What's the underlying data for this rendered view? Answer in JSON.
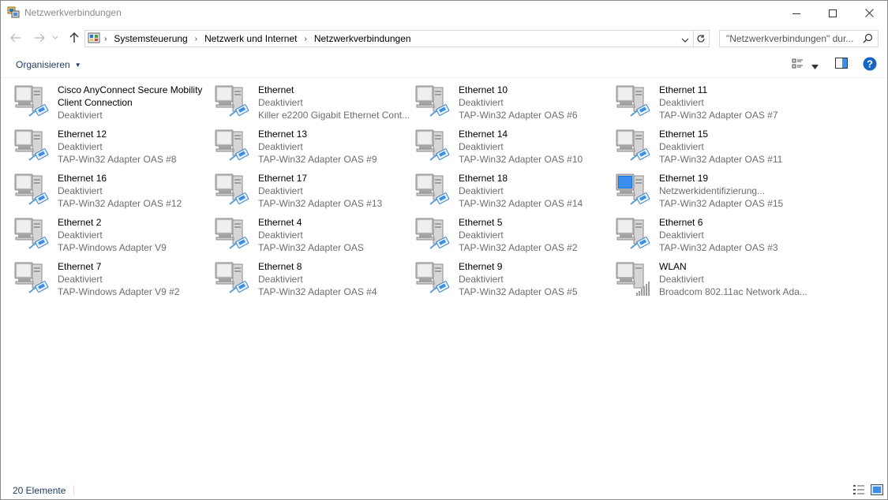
{
  "window": {
    "title": "Netzwerkverbindungen"
  },
  "address": {
    "crumbs": [
      "Systemsteuerung",
      "Netzwerk und Internet",
      "Netzwerkverbindungen"
    ],
    "search_placeholder": "\"Netzwerkverbindungen\" dur..."
  },
  "toolbar": {
    "organize_label": "Organisieren"
  },
  "items": [
    {
      "name": "Cisco AnyConnect Secure Mobility Client Connection",
      "status": "Deaktiviert",
      "device": "",
      "icon": "disabled-ethernet"
    },
    {
      "name": "Ethernet",
      "status": "Deaktiviert",
      "device": "Killer e2200 Gigabit Ethernet Cont...",
      "icon": "disabled-ethernet"
    },
    {
      "name": "Ethernet 10",
      "status": "Deaktiviert",
      "device": "TAP-Win32 Adapter OAS #6",
      "icon": "disabled-ethernet"
    },
    {
      "name": "Ethernet 11",
      "status": "Deaktiviert",
      "device": "TAP-Win32 Adapter OAS #7",
      "icon": "disabled-ethernet"
    },
    {
      "name": "Ethernet 12",
      "status": "Deaktiviert",
      "device": "TAP-Win32 Adapter OAS #8",
      "icon": "disabled-ethernet"
    },
    {
      "name": "Ethernet 13",
      "status": "Deaktiviert",
      "device": "TAP-Win32 Adapter OAS #9",
      "icon": "disabled-ethernet"
    },
    {
      "name": "Ethernet 14",
      "status": "Deaktiviert",
      "device": "TAP-Win32 Adapter OAS #10",
      "icon": "disabled-ethernet"
    },
    {
      "name": "Ethernet 15",
      "status": "Deaktiviert",
      "device": "TAP-Win32 Adapter OAS #11",
      "icon": "disabled-ethernet"
    },
    {
      "name": "Ethernet 16",
      "status": "Deaktiviert",
      "device": "TAP-Win32 Adapter OAS #12",
      "icon": "disabled-ethernet"
    },
    {
      "name": "Ethernet 17",
      "status": "Deaktiviert",
      "device": "TAP-Win32 Adapter OAS #13",
      "icon": "disabled-ethernet"
    },
    {
      "name": "Ethernet 18",
      "status": "Deaktiviert",
      "device": "TAP-Win32 Adapter OAS #14",
      "icon": "disabled-ethernet"
    },
    {
      "name": "Ethernet 19",
      "status": "Netzwerkidentifizierung...",
      "device": "TAP-Win32 Adapter OAS #15",
      "icon": "active-ethernet"
    },
    {
      "name": "Ethernet 2",
      "status": "Deaktiviert",
      "device": "TAP-Windows Adapter V9",
      "icon": "disabled-ethernet"
    },
    {
      "name": "Ethernet 4",
      "status": "Deaktiviert",
      "device": "TAP-Win32 Adapter OAS",
      "icon": "disabled-ethernet"
    },
    {
      "name": "Ethernet 5",
      "status": "Deaktiviert",
      "device": "TAP-Win32 Adapter OAS #2",
      "icon": "disabled-ethernet"
    },
    {
      "name": "Ethernet 6",
      "status": "Deaktiviert",
      "device": "TAP-Win32 Adapter OAS #3",
      "icon": "disabled-ethernet"
    },
    {
      "name": "Ethernet 7",
      "status": "Deaktiviert",
      "device": "TAP-Windows Adapter V9 #2",
      "icon": "disabled-ethernet"
    },
    {
      "name": "Ethernet 8",
      "status": "Deaktiviert",
      "device": "TAP-Win32 Adapter OAS #4",
      "icon": "disabled-ethernet"
    },
    {
      "name": "Ethernet 9",
      "status": "Deaktiviert",
      "device": "TAP-Win32 Adapter OAS #5",
      "icon": "disabled-ethernet"
    },
    {
      "name": "WLAN",
      "status": "Deaktiviert",
      "device": "Broadcom 802.11ac Network Ada...",
      "icon": "wifi-signal"
    }
  ],
  "statusbar": {
    "count_label": "20 Elemente"
  },
  "colors": {
    "accent": "#0063b1",
    "text_link": "#1e3a5f",
    "muted": "#6d6d6d",
    "active_screen": "#1a73d9"
  }
}
